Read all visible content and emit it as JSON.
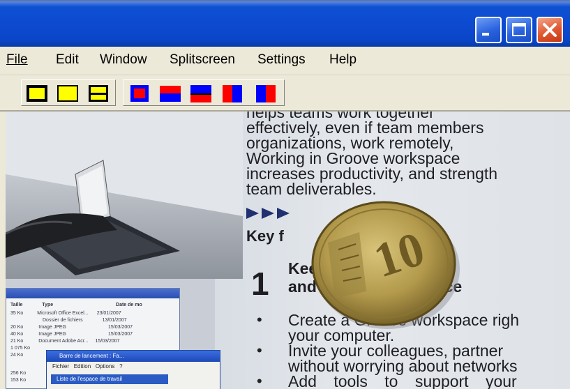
{
  "menu": {
    "file": "File",
    "edit": "Edit",
    "window": "Window",
    "splitscreen": "Splitscreen",
    "settings": "Settings",
    "help": "Help"
  },
  "titlebar_buttons": [
    "minimize-icon",
    "maximize-icon",
    "close-icon"
  ],
  "toolbar_icons": [
    "view-single-yellow-icon",
    "view-single-yellow-wide-icon",
    "view-split-yellow-icon",
    "split-red-blue-center-icon",
    "split-horizontal-red-blue-icon",
    "split-horizontal-blue-red-icon",
    "split-vertical-red-blue-icon",
    "split-vertical-blue-red-icon"
  ],
  "colors": {
    "title_blue": "#0c4ad0",
    "yellow": "#ffff00",
    "red": "#ff0000",
    "blue": "#0000ff",
    "close_red": "#e0572f"
  },
  "document": {
    "lines": [
      "helps teams work together",
      "effectively, even if team members",
      "organizations,  work  remotely,",
      "Working  in  Groove  workspace",
      "increases productivity, and strength",
      "team deliverables."
    ],
    "key_heading": "Key f",
    "number": "1",
    "heading1": "Keep       , tools, files,",
    "heading2": "and inf              on in one place",
    "bullets": [
      "Create a Groove workspace righ",
      "your computer.",
      "Invite your colleagues, partner",
      "without worrying about networks",
      "Add tools to support your"
    ]
  },
  "mini_screenshot": {
    "columns": [
      "Taille",
      "Type",
      "Date de mo"
    ],
    "rows": [
      [
        "35 Ko",
        "Microsoft Office Excel...",
        "23/01/2007"
      ],
      [
        "",
        "Dossier de fichiers",
        "13/01/2007"
      ],
      [
        "20 Ko",
        "Image JPEG",
        "15/03/2007"
      ],
      [
        "40 Ko",
        "Image JPEG",
        "15/03/2007"
      ],
      [
        "21 Ko",
        "Document Adobe Acr...",
        "15/03/2007"
      ],
      [
        "1 075 Ko",
        "",
        ""
      ],
      [
        "24 Ko",
        "",
        ""
      ],
      [
        "256 Ko",
        "",
        ""
      ],
      [
        "153 Ko",
        "",
        ""
      ]
    ],
    "dialog_title": "Barre de lancement : Fa...",
    "dialog_menu": [
      "Fichier",
      "Edition",
      "Options",
      "?"
    ],
    "dialog_selected": "Liste de l'espace de travail"
  }
}
